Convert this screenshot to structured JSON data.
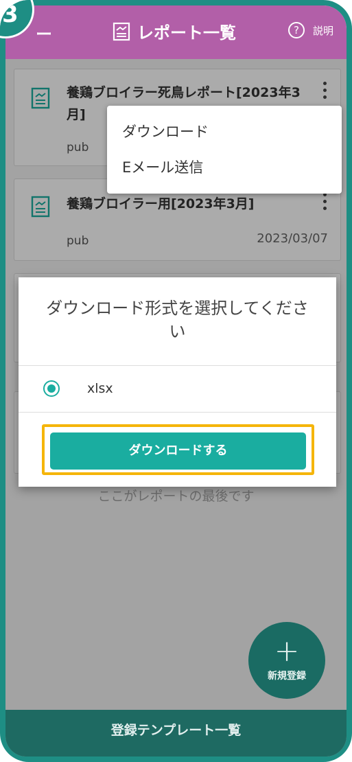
{
  "header": {
    "back_label": "ー",
    "title": "レポート一覧",
    "help_symbol": "?",
    "help_label": "説明"
  },
  "step_badge": "3",
  "cards": [
    {
      "title": "養鶏ブロイラー死鳥レポート[2023年3月]",
      "user": "pub",
      "date": ""
    },
    {
      "title": "養鶏ブロイラー用[2023年3月]",
      "user": "pub",
      "date": "2023/03/07"
    }
  ],
  "context_menu": {
    "items": [
      "ダウンロード",
      "Eメール送信"
    ]
  },
  "dialog": {
    "title": "ダウンロード形式を選択してください",
    "option_label": "xlsx",
    "button_label": "ダウンロードする"
  },
  "end_text": "ここがレポートの最後です",
  "fab": {
    "icon": "plus-icon",
    "label": "新規登録"
  },
  "bottom_bar": {
    "label": "登録テンプレート一覧"
  },
  "colors": {
    "header": "#b25fa8",
    "accent": "#1aada0",
    "frame": "#1e8e84",
    "highlight": "#f5b50a"
  }
}
